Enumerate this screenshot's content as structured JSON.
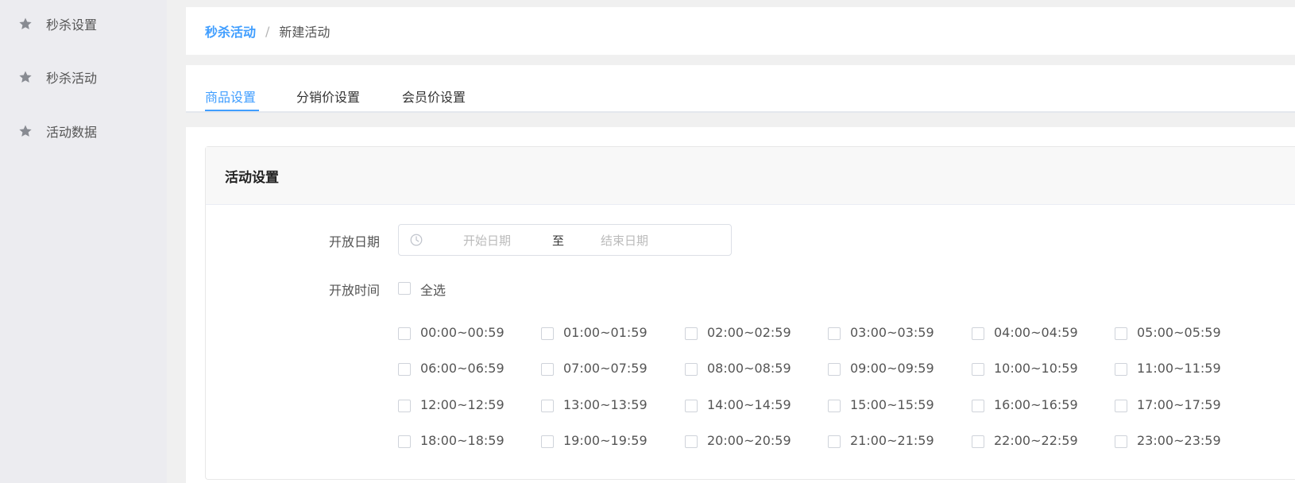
{
  "sidebar": {
    "items": [
      {
        "label": "秒杀设置",
        "icon": "star-icon"
      },
      {
        "label": "秒杀活动",
        "icon": "star-icon"
      },
      {
        "label": "活动数据",
        "icon": "star-icon"
      }
    ]
  },
  "breadcrumb": {
    "parent": "秒杀活动",
    "separator": "/",
    "current": "新建活动"
  },
  "tabs": [
    {
      "label": "商品设置",
      "active": true
    },
    {
      "label": "分销价设置",
      "active": false
    },
    {
      "label": "会员价设置",
      "active": false
    }
  ],
  "card": {
    "title": "活动设置"
  },
  "form": {
    "open_date_label": "开放日期",
    "date_start_placeholder": "开始日期",
    "date_separator": "至",
    "date_end_placeholder": "结束日期",
    "open_time_label": "开放时间",
    "select_all_label": "全选",
    "time_slots": [
      "00:00~00:59",
      "01:00~01:59",
      "02:00~02:59",
      "03:00~03:59",
      "04:00~04:59",
      "05:00~05:59",
      "06:00~06:59",
      "07:00~07:59",
      "08:00~08:59",
      "09:00~09:59",
      "10:00~10:59",
      "11:00~11:59",
      "12:00~12:59",
      "13:00~13:59",
      "14:00~14:59",
      "15:00~15:59",
      "16:00~16:59",
      "17:00~17:59",
      "18:00~18:59",
      "19:00~19:59",
      "20:00~20:59",
      "21:00~21:59",
      "22:00~22:59",
      "23:00~23:59"
    ]
  },
  "colors": {
    "accent": "#409eff",
    "sidebar_bg": "#ececf0",
    "page_bg": "#f0f0f0"
  }
}
